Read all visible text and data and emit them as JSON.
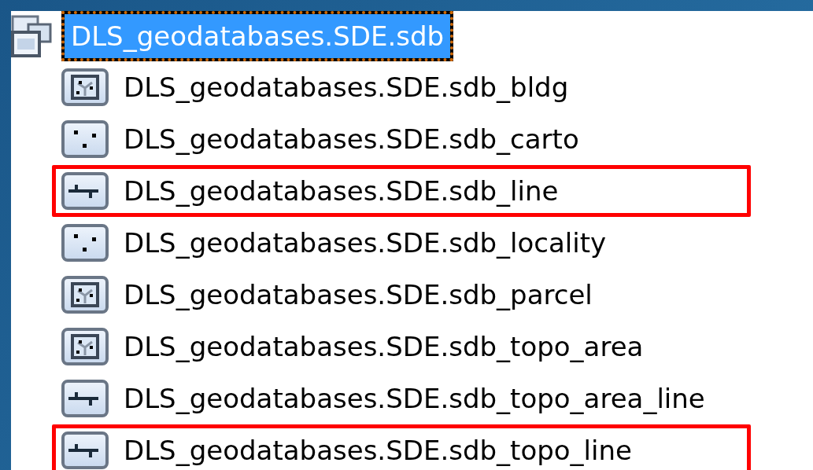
{
  "tree": {
    "root": {
      "label": "DLS_geodatabases.SDE.sdb",
      "selected": true
    },
    "items": [
      {
        "label": "DLS_geodatabases.SDE.sdb_bldg",
        "kind": "polygon",
        "highlighted": false
      },
      {
        "label": "DLS_geodatabases.SDE.sdb_carto",
        "kind": "point",
        "highlighted": false
      },
      {
        "label": "DLS_geodatabases.SDE.sdb_line",
        "kind": "line",
        "highlighted": true
      },
      {
        "label": "DLS_geodatabases.SDE.sdb_locality",
        "kind": "point",
        "highlighted": false
      },
      {
        "label": "DLS_geodatabases.SDE.sdb_parcel",
        "kind": "polygon",
        "highlighted": false
      },
      {
        "label": "DLS_geodatabases.SDE.sdb_topo_area",
        "kind": "polygon",
        "highlighted": false
      },
      {
        "label": "DLS_geodatabases.SDE.sdb_topo_area_line",
        "kind": "line",
        "highlighted": false
      },
      {
        "label": "DLS_geodatabases.SDE.sdb_topo_line",
        "kind": "line",
        "highlighted": true
      }
    ]
  }
}
